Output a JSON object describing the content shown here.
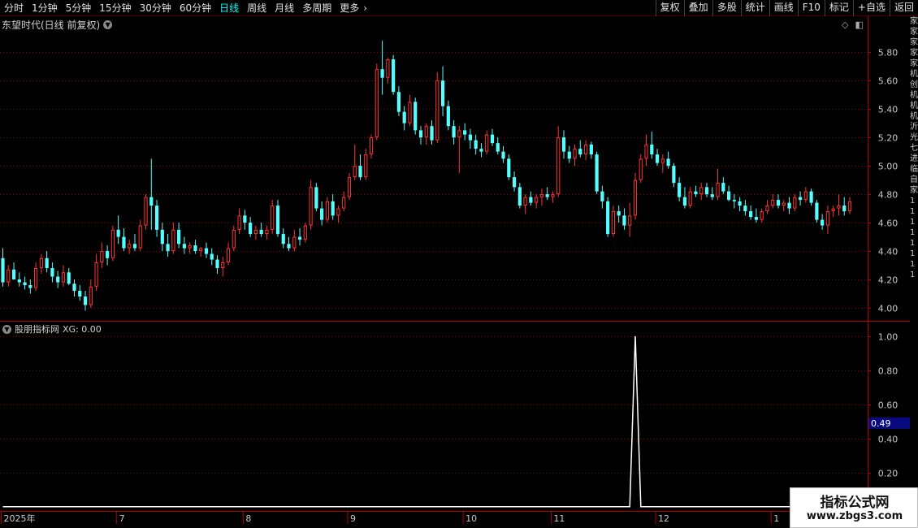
{
  "toolbar": {
    "periods": [
      "分时",
      "1分钟",
      "5分钟",
      "15分钟",
      "30分钟",
      "60分钟",
      "日线",
      "周线",
      "月线",
      "多周期",
      "更多"
    ],
    "active_period": "日线",
    "more_arrow": "›",
    "buttons": [
      "复权",
      "叠加",
      "多股",
      "统计",
      "画线",
      "F10",
      "标记",
      "+自选",
      "返回"
    ]
  },
  "main_panel": {
    "title": "东望时代(日线 前复权)",
    "corner_icons": [
      "diamond-icon",
      "panel-toggle-icon"
    ]
  },
  "sub_panel": {
    "title": "股朋指标网",
    "indicator_label": "XG: 0.00",
    "current_value_tag": "0.49"
  },
  "colors": {
    "up": "#ff3232",
    "down": "#54ffff",
    "grid": "#8a0000",
    "border": "#b00000",
    "axis_text": "#c8c8c8",
    "signal_line": "#ffffff",
    "value_tag_bg": "#0a0a80"
  },
  "right_strip": [
    "家",
    "家",
    "家",
    "家",
    "家",
    "机",
    "创",
    "机",
    "机",
    "机",
    "沂",
    "光",
    "七",
    "进",
    "临",
    "自",
    "家",
    "1",
    "1",
    "1",
    "1",
    "1",
    "1",
    "1",
    "1"
  ],
  "watermark": {
    "title": "指标公式网",
    "url": "www.zbgs3.com"
  },
  "chart_data": [
    {
      "type": "candlestick",
      "title": "东望时代(日线 前复权)",
      "y_ticks": [
        "5.80",
        "5.60",
        "5.40",
        "5.20",
        "5.00",
        "4.80",
        "4.60",
        "4.40",
        "4.20",
        "4.00"
      ],
      "ylim": [
        3.92,
        5.95
      ],
      "grid": true,
      "x_labels": [
        {
          "label": "2025年",
          "index": 0
        },
        {
          "label": "7",
          "index": 21
        },
        {
          "label": "8",
          "index": 44
        },
        {
          "label": "9",
          "index": 63
        },
        {
          "label": "10",
          "index": 84
        },
        {
          "label": "11",
          "index": 100
        },
        {
          "label": "12",
          "index": 119
        },
        {
          "label": "1",
          "index": 140
        }
      ],
      "ohlc": [
        [
          4.35,
          4.42,
          4.15,
          4.18
        ],
        [
          4.18,
          4.3,
          4.15,
          4.27
        ],
        [
          4.27,
          4.32,
          4.2,
          4.2
        ],
        [
          4.2,
          4.25,
          4.15,
          4.18
        ],
        [
          4.18,
          4.22,
          4.13,
          4.16
        ],
        [
          4.16,
          4.2,
          4.1,
          4.14
        ],
        [
          4.14,
          4.32,
          4.12,
          4.28
        ],
        [
          4.28,
          4.38,
          4.24,
          4.35
        ],
        [
          4.35,
          4.4,
          4.25,
          4.28
        ],
        [
          4.28,
          4.32,
          4.18,
          4.22
        ],
        [
          4.22,
          4.26,
          4.14,
          4.18
        ],
        [
          4.18,
          4.3,
          4.15,
          4.25
        ],
        [
          4.25,
          4.28,
          4.16,
          4.17
        ],
        [
          4.17,
          4.2,
          4.08,
          4.12
        ],
        [
          4.12,
          4.16,
          4.05,
          4.08
        ],
        [
          4.08,
          4.12,
          3.98,
          4.02
        ],
        [
          4.02,
          4.2,
          4.0,
          4.15
        ],
        [
          4.15,
          4.38,
          4.12,
          4.32
        ],
        [
          4.32,
          4.46,
          4.28,
          4.4
        ],
        [
          4.4,
          4.44,
          4.3,
          4.35
        ],
        [
          4.35,
          4.58,
          4.33,
          4.55
        ],
        [
          4.55,
          4.65,
          4.45,
          4.5
        ],
        [
          4.5,
          4.56,
          4.4,
          4.42
        ],
        [
          4.42,
          4.48,
          4.38,
          4.45
        ],
        [
          4.45,
          4.52,
          4.4,
          4.42
        ],
        [
          4.42,
          4.62,
          4.4,
          4.58
        ],
        [
          4.58,
          4.8,
          4.55,
          4.78
        ],
        [
          4.78,
          5.05,
          4.55,
          4.72
        ],
        [
          4.72,
          4.76,
          4.5,
          4.55
        ],
        [
          4.55,
          4.6,
          4.4,
          4.45
        ],
        [
          4.45,
          4.52,
          4.36,
          4.4
        ],
        [
          4.4,
          4.6,
          4.38,
          4.55
        ],
        [
          4.55,
          4.6,
          4.42,
          4.45
        ],
        [
          4.45,
          4.5,
          4.38,
          4.42
        ],
        [
          4.42,
          4.46,
          4.38,
          4.44
        ],
        [
          4.44,
          4.48,
          4.38,
          4.4
        ],
        [
          4.4,
          4.43,
          4.36,
          4.42
        ],
        [
          4.42,
          4.46,
          4.35,
          4.38
        ],
        [
          4.38,
          4.42,
          4.3,
          4.34
        ],
        [
          4.34,
          4.37,
          4.24,
          4.28
        ],
        [
          4.28,
          4.36,
          4.22,
          4.32
        ],
        [
          4.32,
          4.46,
          4.3,
          4.42
        ],
        [
          4.42,
          4.58,
          4.4,
          4.55
        ],
        [
          4.55,
          4.7,
          4.52,
          4.65
        ],
        [
          4.65,
          4.69,
          4.55,
          4.6
        ],
        [
          4.6,
          4.64,
          4.5,
          4.52
        ],
        [
          4.52,
          4.58,
          4.48,
          4.55
        ],
        [
          4.55,
          4.6,
          4.5,
          4.52
        ],
        [
          4.52,
          4.58,
          4.48,
          4.55
        ],
        [
          4.55,
          4.76,
          4.52,
          4.72
        ],
        [
          4.72,
          4.76,
          4.5,
          4.52
        ],
        [
          4.52,
          4.56,
          4.42,
          4.45
        ],
        [
          4.45,
          4.5,
          4.4,
          4.42
        ],
        [
          4.42,
          4.55,
          4.4,
          4.5
        ],
        [
          4.5,
          4.56,
          4.44,
          4.48
        ],
        [
          4.48,
          4.6,
          4.46,
          4.58
        ],
        [
          4.58,
          4.9,
          4.55,
          4.85
        ],
        [
          4.85,
          4.88,
          4.68,
          4.7
        ],
        [
          4.7,
          4.75,
          4.58,
          4.62
        ],
        [
          4.62,
          4.78,
          4.6,
          4.75
        ],
        [
          4.75,
          4.8,
          4.62,
          4.65
        ],
        [
          4.65,
          4.72,
          4.6,
          4.7
        ],
        [
          4.7,
          4.82,
          4.68,
          4.78
        ],
        [
          4.78,
          4.95,
          4.76,
          4.92
        ],
        [
          4.92,
          5.15,
          4.9,
          5.0
        ],
        [
          5.0,
          5.08,
          4.9,
          4.92
        ],
        [
          4.92,
          5.12,
          4.9,
          5.08
        ],
        [
          5.08,
          5.22,
          5.05,
          5.2
        ],
        [
          5.2,
          5.72,
          5.18,
          5.68
        ],
        [
          5.68,
          5.88,
          5.5,
          5.62
        ],
        [
          5.62,
          5.76,
          5.58,
          5.75
        ],
        [
          5.75,
          5.78,
          5.5,
          5.52
        ],
        [
          5.52,
          5.56,
          5.35,
          5.38
        ],
        [
          5.38,
          5.42,
          5.25,
          5.3
        ],
        [
          5.3,
          5.5,
          5.28,
          5.45
        ],
        [
          5.45,
          5.48,
          5.22,
          5.25
        ],
        [
          5.25,
          5.28,
          5.15,
          5.2
        ],
        [
          5.2,
          5.3,
          5.15,
          5.28
        ],
        [
          5.28,
          5.32,
          5.15,
          5.18
        ],
        [
          5.18,
          5.66,
          5.16,
          5.6
        ],
        [
          5.6,
          5.7,
          5.35,
          5.42
        ],
        [
          5.42,
          5.46,
          5.25,
          5.28
        ],
        [
          5.28,
          5.32,
          5.15,
          5.2
        ],
        [
          5.2,
          5.28,
          4.95,
          5.25
        ],
        [
          5.25,
          5.3,
          5.18,
          5.22
        ],
        [
          5.22,
          5.26,
          5.12,
          5.18
        ],
        [
          5.18,
          5.22,
          5.08,
          5.12
        ],
        [
          5.12,
          5.16,
          5.06,
          5.1
        ],
        [
          5.1,
          5.25,
          5.08,
          5.22
        ],
        [
          5.22,
          5.26,
          5.14,
          5.16
        ],
        [
          5.16,
          5.2,
          5.08,
          5.1
        ],
        [
          5.1,
          5.14,
          5.02,
          5.05
        ],
        [
          5.05,
          5.08,
          4.9,
          4.92
        ],
        [
          4.92,
          4.96,
          4.82,
          4.85
        ],
        [
          4.85,
          4.88,
          4.7,
          4.72
        ],
        [
          4.72,
          4.8,
          4.66,
          4.78
        ],
        [
          4.78,
          4.82,
          4.72,
          4.74
        ],
        [
          4.74,
          4.8,
          4.7,
          4.78
        ],
        [
          4.78,
          4.84,
          4.72,
          4.8
        ],
        [
          4.8,
          4.85,
          4.76,
          4.78
        ],
        [
          4.78,
          4.82,
          4.74,
          4.8
        ],
        [
          4.8,
          5.28,
          4.78,
          5.2
        ],
        [
          5.2,
          5.25,
          5.05,
          5.1
        ],
        [
          5.1,
          5.14,
          5.02,
          5.05
        ],
        [
          5.05,
          5.15,
          5.0,
          5.12
        ],
        [
          5.12,
          5.18,
          5.06,
          5.08
        ],
        [
          5.08,
          5.18,
          5.04,
          5.15
        ],
        [
          5.15,
          5.17,
          5.05,
          5.08
        ],
        [
          5.08,
          5.1,
          4.8,
          4.82
        ],
        [
          4.82,
          4.86,
          4.7,
          4.75
        ],
        [
          4.75,
          4.78,
          4.5,
          4.52
        ],
        [
          4.52,
          4.72,
          4.5,
          4.68
        ],
        [
          4.68,
          4.72,
          4.6,
          4.65
        ],
        [
          4.65,
          4.7,
          4.55,
          4.58
        ],
        [
          4.58,
          4.74,
          4.5,
          4.65
        ],
        [
          4.65,
          4.95,
          4.62,
          4.9
        ],
        [
          4.9,
          5.08,
          4.88,
          5.05
        ],
        [
          5.05,
          5.22,
          5.0,
          5.15
        ],
        [
          5.15,
          5.24,
          5.05,
          5.08
        ],
        [
          5.08,
          5.12,
          5.0,
          5.02
        ],
        [
          5.02,
          5.08,
          4.95,
          5.05
        ],
        [
          5.05,
          5.1,
          4.98,
          5.0
        ],
        [
          5.0,
          5.02,
          4.85,
          4.88
        ],
        [
          4.88,
          4.92,
          4.75,
          4.78
        ],
        [
          4.78,
          4.85,
          4.7,
          4.72
        ],
        [
          4.72,
          4.85,
          4.7,
          4.82
        ],
        [
          4.82,
          4.86,
          4.78,
          4.8
        ],
        [
          4.8,
          4.88,
          4.76,
          4.85
        ],
        [
          4.85,
          4.88,
          4.78,
          4.8
        ],
        [
          4.8,
          4.85,
          4.76,
          4.78
        ],
        [
          4.78,
          4.98,
          4.76,
          4.88
        ],
        [
          4.88,
          4.92,
          4.8,
          4.82
        ],
        [
          4.82,
          4.86,
          4.75,
          4.76
        ],
        [
          4.76,
          4.8,
          4.7,
          4.75
        ],
        [
          4.75,
          4.78,
          4.68,
          4.72
        ],
        [
          4.72,
          4.76,
          4.65,
          4.68
        ],
        [
          4.68,
          4.72,
          4.62,
          4.64
        ],
        [
          4.64,
          4.7,
          4.6,
          4.62
        ],
        [
          4.62,
          4.7,
          4.6,
          4.68
        ],
        [
          4.68,
          4.76,
          4.66,
          4.72
        ],
        [
          4.72,
          4.8,
          4.7,
          4.76
        ],
        [
          4.76,
          4.8,
          4.7,
          4.72
        ],
        [
          4.72,
          4.76,
          4.68,
          4.74
        ],
        [
          4.74,
          4.78,
          4.66,
          4.7
        ],
        [
          4.7,
          4.8,
          4.68,
          4.78
        ],
        [
          4.78,
          4.82,
          4.72,
          4.76
        ],
        [
          4.76,
          4.85,
          4.74,
          4.82
        ],
        [
          4.82,
          4.84,
          4.72,
          4.74
        ],
        [
          4.74,
          4.76,
          4.6,
          4.62
        ],
        [
          4.62,
          4.66,
          4.55,
          4.58
        ],
        [
          4.58,
          4.72,
          4.52,
          4.68
        ],
        [
          4.68,
          4.72,
          4.64,
          4.7
        ],
        [
          4.7,
          4.8,
          4.65,
          4.72
        ],
        [
          4.72,
          4.78,
          4.65,
          4.68
        ],
        [
          4.68,
          4.78,
          4.66,
          4.75
        ]
      ]
    },
    {
      "type": "line",
      "title": "股朋指标网",
      "series": [
        {
          "name": "XG",
          "values": [
            {
              "index": 0,
              "value": 0
            },
            {
              "index": 114,
              "value": 0
            },
            {
              "index": 115,
              "value": 1
            },
            {
              "index": 116,
              "value": 0
            },
            {
              "index": 157,
              "value": 0
            }
          ]
        }
      ],
      "y_ticks": [
        "1.00",
        "0.80",
        "0.60",
        "0.40",
        "0.20"
      ],
      "ylim": [
        -0.02,
        1.08
      ],
      "grid": true
    }
  ]
}
